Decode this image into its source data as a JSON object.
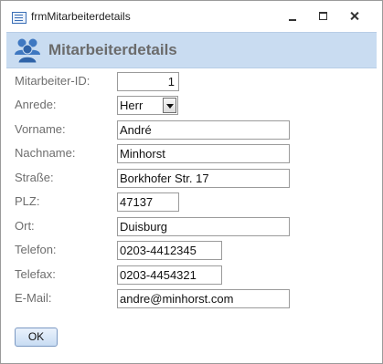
{
  "window": {
    "title": "frmMitarbeiterdetails"
  },
  "header": {
    "title": "Mitarbeiterdetails",
    "band_color": "#c9dcf1"
  },
  "fields": {
    "mitarbeiter_id": {
      "label": "Mitarbeiter-ID:",
      "value": "1"
    },
    "anrede": {
      "label": "Anrede:",
      "value": "Herr"
    },
    "vorname": {
      "label": "Vorname:",
      "value": "André"
    },
    "nachname": {
      "label": "Nachname:",
      "value": "Minhorst"
    },
    "strasse": {
      "label": "Straße:",
      "value": "Borkhofer Str. 17"
    },
    "plz": {
      "label": "PLZ:",
      "value": "47137"
    },
    "ort": {
      "label": "Ort:",
      "value": "Duisburg"
    },
    "telefon": {
      "label": "Telefon:",
      "value": "0203-4412345"
    },
    "telefax": {
      "label": "Telefax:",
      "value": "0203-4454321"
    },
    "email": {
      "label": "E-Mail:",
      "value": "andre@minhorst.com"
    }
  },
  "buttons": {
    "ok_label": "OK"
  },
  "icons": {
    "window_icon": "form-icon",
    "header_icon": "users-icon",
    "minimize": "minimize-icon",
    "maximize": "maximize-icon",
    "close": "close-icon"
  }
}
